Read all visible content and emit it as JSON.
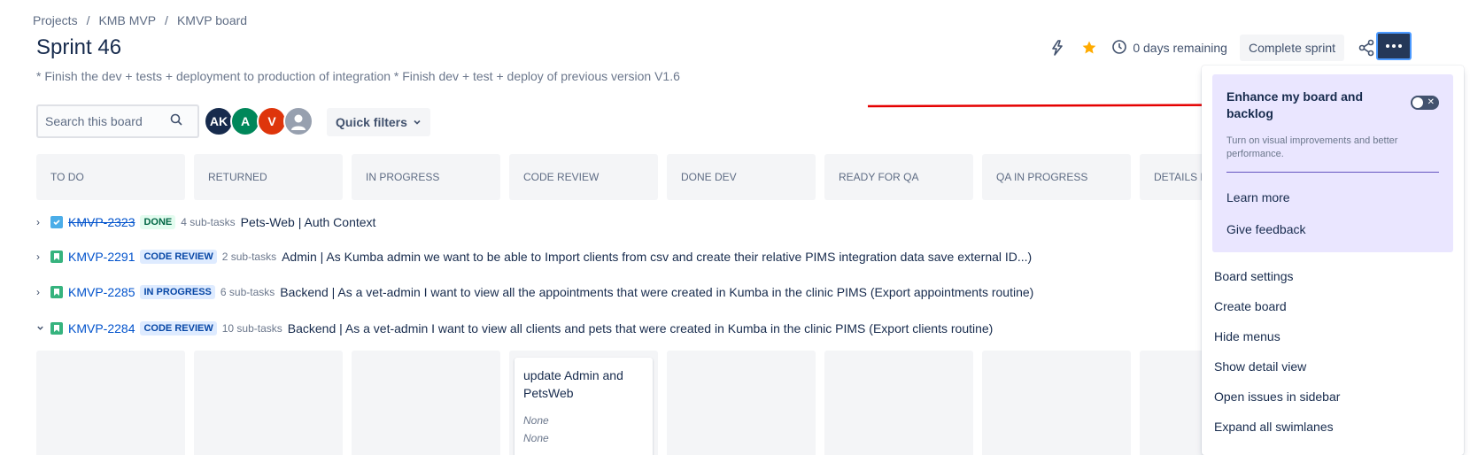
{
  "breadcrumb": {
    "items": [
      "Projects",
      "KMB MVP",
      "KMVP board"
    ],
    "separator": "/"
  },
  "page": {
    "title": "Sprint 46",
    "goal": "* Finish the dev + tests + deployment to production of integration * Finish dev + test + deploy of previous version V1.6"
  },
  "header": {
    "lightning_icon": "lightning-icon",
    "star_icon": "star-icon",
    "days_remaining": "0 days remaining",
    "complete_sprint": "Complete sprint",
    "share_icon": "share-icon",
    "more_icon": "more-icon"
  },
  "search": {
    "placeholder": "Search this board"
  },
  "avatars": [
    {
      "initials": "AK",
      "color": "#172b4d"
    },
    {
      "initials": "A",
      "color": "#00875a"
    },
    {
      "initials": "V",
      "color": "#de350b"
    }
  ],
  "quick_filters": {
    "label": "Quick filters"
  },
  "columns": [
    "TO DO",
    "RETURNED",
    "IN PROGRESS",
    "CODE REVIEW",
    "DONE DEV",
    "READY FOR QA",
    "QA IN PROGRESS",
    "DETAILS R"
  ],
  "swimlanes": [
    {
      "key": "KMVP-2323",
      "status": "DONE",
      "subtasks": "4 sub-tasks",
      "summary": "Pets-Web | Auth Context",
      "done": true
    },
    {
      "key": "KMVP-2291",
      "status": "CODE REVIEW",
      "subtasks": "2 sub-tasks",
      "summary": "Admin | As Kumba admin we want to be able to Import clients from csv and create their relative PIMS integration data save external ID...)"
    },
    {
      "key": "KMVP-2285",
      "status": "IN PROGRESS",
      "subtasks": "6 sub-tasks",
      "summary": "Backend | As a vet-admin I want to view all the appointments that were created in Kumba in the clinic PIMS (Export appointments routine)"
    },
    {
      "key": "KMVP-2284",
      "status": "CODE REVIEW",
      "subtasks": "10 sub-tasks",
      "summary": "Backend | As a vet-admin I want to view all clients and pets that were created in Kumba in the clinic PIMS (Export clients routine)"
    }
  ],
  "card": {
    "title": "update Admin and PetsWeb",
    "field1": "None",
    "field2": "None"
  },
  "menu": {
    "enhance_title": "Enhance my board and backlog",
    "enhance_desc": "Turn on visual improvements and better performance.",
    "learn_more": "Learn more",
    "give_feedback": "Give feedback",
    "items": [
      "Board settings",
      "Create board",
      "Hide menus",
      "Show detail view",
      "Open issues in sidebar",
      "Expand all swimlanes"
    ]
  },
  "colors": {
    "done_bg": "#e3fcef",
    "done_fg": "#006644",
    "review_bg": "#deebff",
    "review_fg": "#0747a6",
    "story": "#36b37e",
    "task": "#4bade8",
    "annotation_arrow": "#e50000"
  }
}
